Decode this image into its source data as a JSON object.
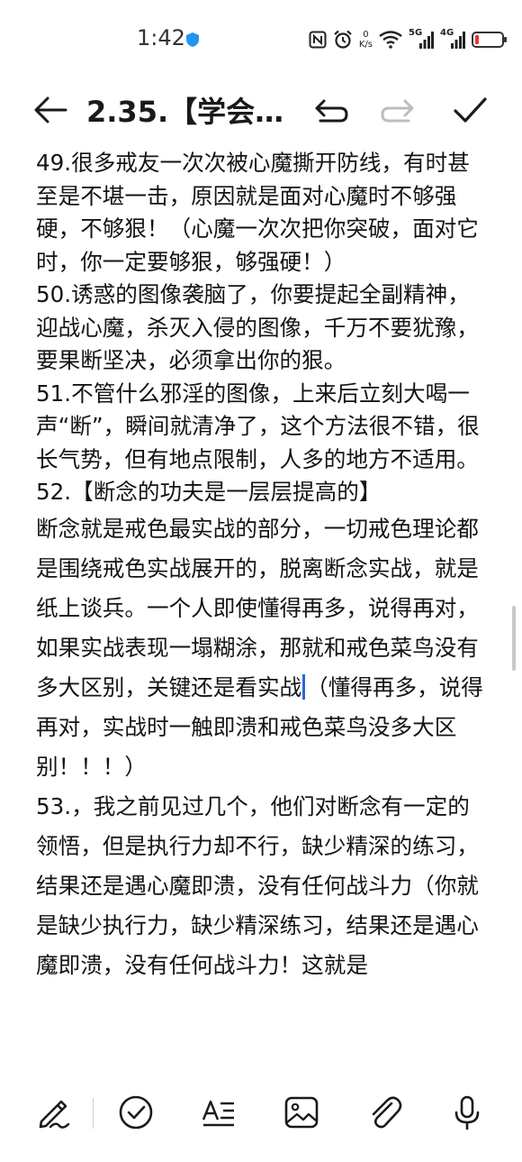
{
  "status_bar": {
    "time": "1:42",
    "net_speed_value": "0",
    "net_speed_unit": "K/s",
    "network_5g": "5G",
    "network_4g": "4G",
    "battery_level": 0.15,
    "battery_color": "#e53935"
  },
  "toolbar": {
    "title": "2.35.【学会…"
  },
  "note": {
    "paragraphs": [
      "49.很多戒友一次次被心魔撕开防线，有时甚至是不堪一击，原因就是面对心魔时不够强硬，不够狠！（心魔一次次把你突破，面对它时，你一定要够狠，够强硬！）",
      "50.诱惑的图像袭脑了，你要提起全副精神，迎战心魔，杀灭入侵的图像，千万不要犹豫，要果断坚决，必须拿出你的狠。",
      "51.不管什么邪淫的图像，上来后立刻大喝一声“断”，瞬间就清净了，这个方法很不错，很长气势，但有地点限制，人多的地方不适用。",
      "52.【断念的功夫是一层层提高的】",
      "断念就是戒色最实战的部分，一切戒色理论都是围绕戒色实战展开的，脱离断念实战，就是纸上谈兵。一个人即使懂得再多，说得再对，如果实战表现一塌糊涂，那就和戒色菜鸟没有多大区别，关键还是看实战",
      "（懂得再多，说得再对，实战时一触即溃和戒色菜鸟没多大区别！！！）",
      "53.，我之前见过几个，他们对断念有一定的领悟，但是执行力却不行，缺少精深的练习，结果还是遇心魔即溃，没有任何战斗力（你就是缺少执行力，缺少精深练习，结果还是遇心魔即溃，没有任何战斗力！这就是"
    ]
  },
  "icons": {
    "accent": "#2a66d8",
    "back": "arrow-left-icon",
    "undo": "undo-icon",
    "redo": "redo-icon",
    "done": "check-icon",
    "bottom": [
      "pen-icon",
      "checklist-icon",
      "text-style-icon",
      "image-icon",
      "attachment-icon",
      "microphone-icon"
    ]
  }
}
